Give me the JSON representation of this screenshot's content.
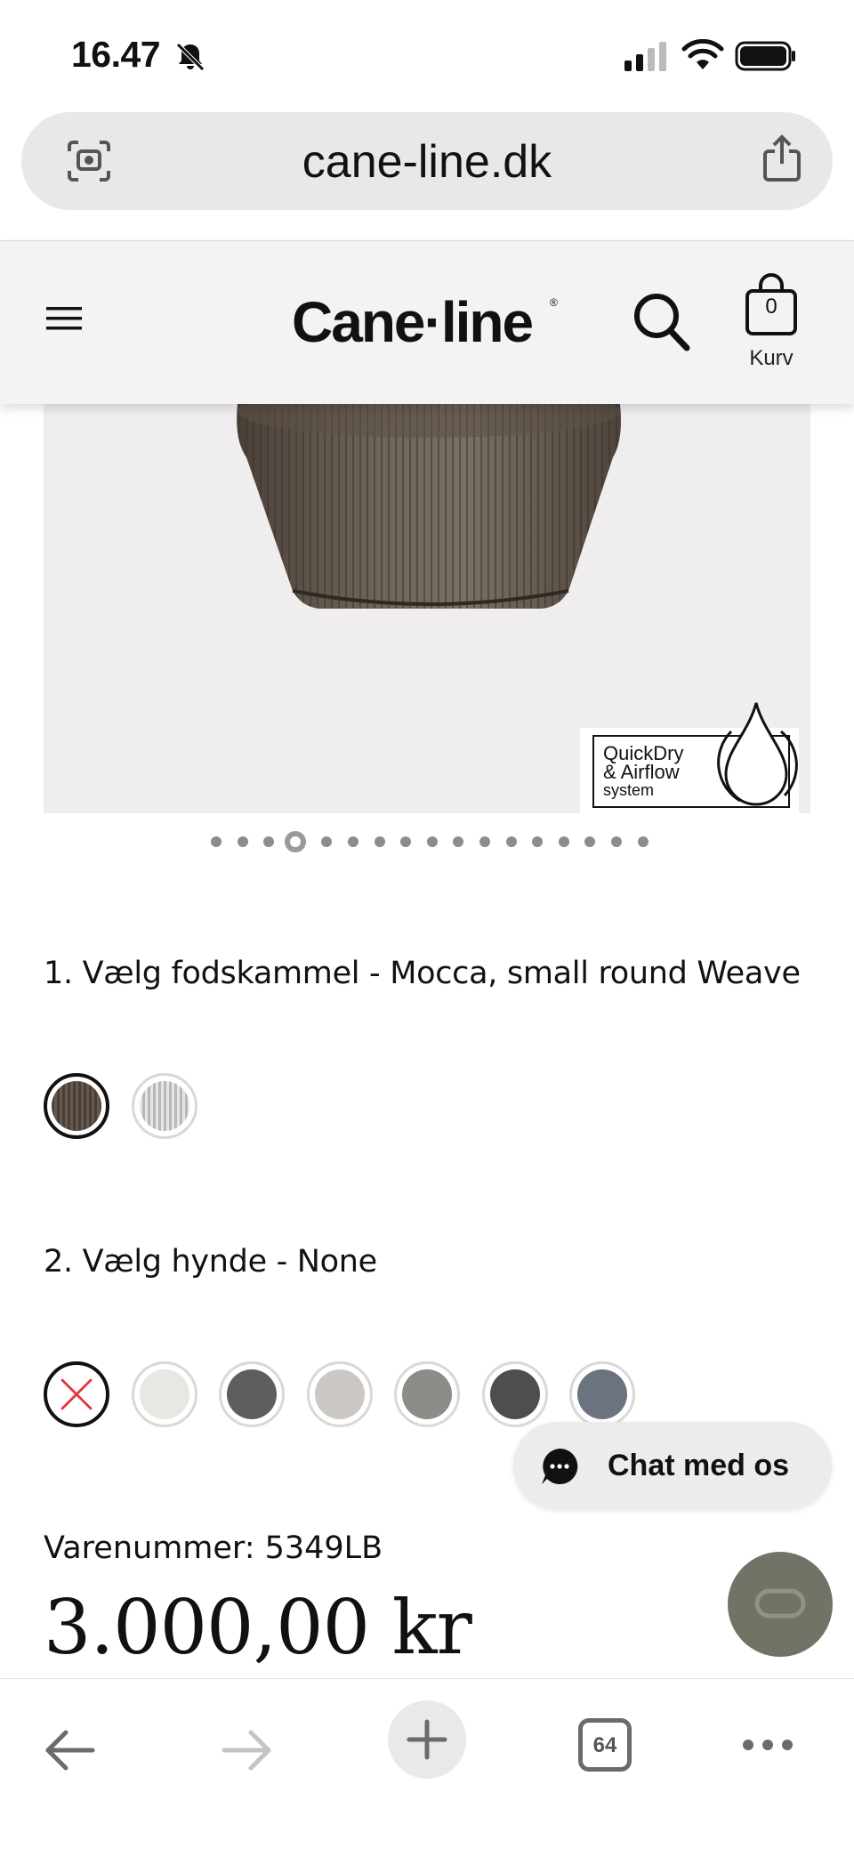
{
  "status_bar": {
    "time": "16.47",
    "icons": [
      "bell-slash-icon",
      "cellular-signal-icon",
      "wifi-icon",
      "battery-icon"
    ]
  },
  "browser": {
    "url": "cane-line.dk",
    "tabs_count": "64",
    "icons": [
      "lens-icon",
      "share-icon",
      "back-icon",
      "forward-icon",
      "new-tab-icon",
      "tabs-icon",
      "more-icon"
    ]
  },
  "site_header": {
    "logo": "Cane·line",
    "logo_mark": "®",
    "cart_count": "0",
    "cart_label": "Kurv",
    "icons": [
      "menu-icon",
      "search-icon",
      "shopping-bag-icon"
    ]
  },
  "product": {
    "badge": {
      "line1": "QuickDry",
      "line2": "& Airflow",
      "line3": "system"
    },
    "carousel": {
      "count": 17,
      "active_index": 3
    },
    "option1": {
      "title": "1. Vælg fodskammel - Mocca, small round Weave",
      "swatches": [
        {
          "name": "mocca-weave",
          "color": "#4a3f38",
          "selected": true
        },
        {
          "name": "white-grey-weave",
          "color": "#e6e6e6",
          "selected": false
        }
      ]
    },
    "option2": {
      "title": "2. Vælg hynde - None",
      "swatches": [
        {
          "name": "none",
          "color": "#ffffff",
          "selected": true
        },
        {
          "name": "light-white",
          "color": "#e9e7e2",
          "selected": false
        },
        {
          "name": "dark-grey",
          "color": "#5e5e60",
          "selected": false
        },
        {
          "name": "light-grey",
          "color": "#cbc8c4",
          "selected": false
        },
        {
          "name": "mid-grey",
          "color": "#8d8c89",
          "selected": false
        },
        {
          "name": "charcoal",
          "color": "#4e4e4e",
          "selected": false
        },
        {
          "name": "blue-grey",
          "color": "#6c7380",
          "selected": false
        }
      ]
    },
    "sku": "Varenummer: 5349LB",
    "price": "3.000,00 kr"
  },
  "chat": {
    "label": "Chat med os"
  }
}
